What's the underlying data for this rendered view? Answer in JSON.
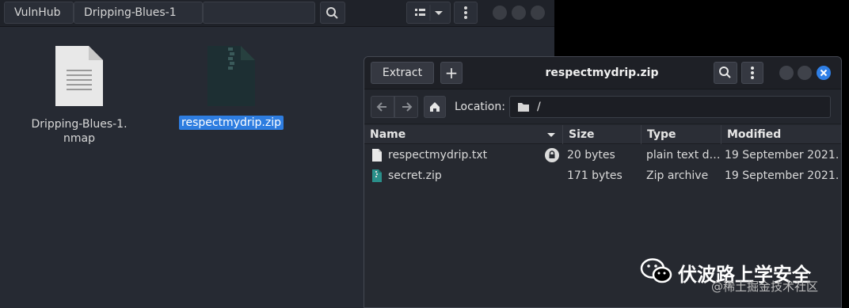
{
  "file_manager": {
    "breadcrumb": [
      "VulnHub",
      "Dripping-Blues-1"
    ],
    "icons": {
      "search": "search-icon",
      "view": "list-view-icon",
      "menu": "kebab-menu-icon"
    },
    "files": [
      {
        "name_line1": "Dripping-Blues-1.",
        "name_line2": "nmap",
        "icon": "text-file-icon"
      },
      {
        "name": "respectmydrip.zip",
        "icon": "zip-file-icon",
        "selected": true
      }
    ]
  },
  "archive": {
    "title": "respectmydrip.zip",
    "extract_label": "Extract",
    "add_label": "+",
    "location_label": "Location:",
    "location_value": "/",
    "columns": [
      "Name",
      "Size",
      "Type",
      "Modified"
    ],
    "rows": [
      {
        "name": "respectmydrip.txt",
        "size": "20 bytes",
        "type": "plain text d…",
        "modified": "19 September 2021…",
        "icon": "text-file-icon",
        "locked": true
      },
      {
        "name": "secret.zip",
        "size": "171 bytes",
        "type": "Zip archive",
        "modified": "19 September 2021…",
        "icon": "zip-file-icon",
        "locked": false
      }
    ]
  },
  "watermark": {
    "title": "伏波路上学安全",
    "subtitle": "@稀土掘金技术社区"
  },
  "colors": {
    "selection": "#2e7de0",
    "close": "#2f7fe6"
  }
}
